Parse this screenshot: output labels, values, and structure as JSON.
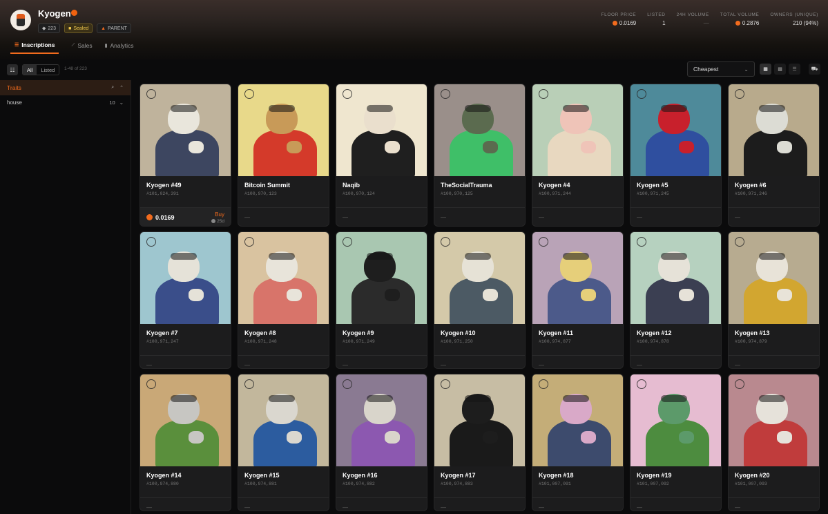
{
  "collection": {
    "name": "Kyogen",
    "badges": [
      {
        "icon": "layers-icon",
        "label": "223"
      },
      {
        "icon": "lock-icon",
        "label": "Sealed"
      },
      {
        "icon": "hierarchy-icon",
        "label": "PARENT"
      }
    ]
  },
  "stats": [
    {
      "label": "FLOOR PRICE",
      "value": "0.0169",
      "btc": true
    },
    {
      "label": "LISTED",
      "value": "1",
      "btc": false
    },
    {
      "label": "24H VOLUME",
      "value": "—",
      "btc": false
    },
    {
      "label": "TOTAL VOLUME",
      "value": "0.2876",
      "btc": true
    },
    {
      "label": "OWNERS (UNIQUE)",
      "value": "210 (94%)",
      "btc": false
    }
  ],
  "tabs": [
    {
      "label": "Inscriptions",
      "icon": "list-icon",
      "active": true
    },
    {
      "label": "Sales",
      "icon": "chart-line-icon",
      "active": false
    },
    {
      "label": "Analytics",
      "icon": "chart-bar-icon",
      "active": false
    }
  ],
  "toolbar": {
    "filter_all": "All",
    "filter_listed": "Listed",
    "count": "1-48 of 223",
    "sort": "Cheapest"
  },
  "sidebar": {
    "traits_title": "Traits",
    "traits": [
      {
        "name": "house",
        "count": "10"
      }
    ]
  },
  "colors": {
    "accent": "#f26b1d",
    "background": "#0b0b0c",
    "card": "#1c1c1d"
  },
  "items": [
    {
      "name": "Kyogen #49",
      "number": "#101,024,391",
      "price": "0.0169",
      "action": "Buy",
      "age": "25d",
      "bg": "#bfb39c",
      "skin": "#e9e6dc",
      "cloth": "#3d4660"
    },
    {
      "name": "Bitcoin Summit",
      "number": "#100,970,123",
      "price": "—",
      "bg": "#e8d98a",
      "skin": "#c89a58",
      "cloth": "#d43a2a"
    },
    {
      "name": "Naqib",
      "number": "#100,970,124",
      "price": "—",
      "bg": "#efe6cf",
      "skin": "#eadfcd",
      "cloth": "#1f1f1f"
    },
    {
      "name": "TheSocialTrauma",
      "number": "#100,970,125",
      "price": "—",
      "bg": "#9a8f8a",
      "skin": "#5b6b4f",
      "cloth": "#3fbf68"
    },
    {
      "name": "Kyogen #4",
      "number": "#100,971,244",
      "price": "—",
      "bg": "#b9cfb7",
      "skin": "#efc4b8",
      "cloth": "#e8d8c0"
    },
    {
      "name": "Kyogen #5",
      "number": "#100,971,245",
      "price": "—",
      "bg": "#4e8a9a",
      "skin": "#c8202c",
      "cloth": "#2f4f9f"
    },
    {
      "name": "Kyogen #6",
      "number": "#100,971,246",
      "price": "—",
      "bg": "#b8aa8c",
      "skin": "#dcdcd4",
      "cloth": "#1c1c1c"
    },
    {
      "name": "Kyogen #7",
      "number": "#100,971,247",
      "price": "—",
      "bg": "#9ec6cf",
      "skin": "#e5e2d8",
      "cloth": "#3a4e8a"
    },
    {
      "name": "Kyogen #8",
      "number": "#100,971,248",
      "price": "—",
      "bg": "#d9c3a0",
      "skin": "#e8e4da",
      "cloth": "#d8746a"
    },
    {
      "name": "Kyogen #9",
      "number": "#100,971,249",
      "price": "—",
      "bg": "#a9c7b1",
      "skin": "#1e1e1e",
      "cloth": "#2b2b2b"
    },
    {
      "name": "Kyogen #10",
      "number": "#100,971,250",
      "price": "—",
      "bg": "#d4c9a9",
      "skin": "#e6e2d6",
      "cloth": "#4c5a64"
    },
    {
      "name": "Kyogen #11",
      "number": "#100,974,877",
      "price": "—",
      "bg": "#b9a3b7",
      "skin": "#e6cf7a",
      "cloth": "#4c5a8a"
    },
    {
      "name": "Kyogen #12",
      "number": "#100,974,878",
      "price": "—",
      "bg": "#b6d1bf",
      "skin": "#e6e2d8",
      "cloth": "#3b3f52"
    },
    {
      "name": "Kyogen #13",
      "number": "#100,974,879",
      "price": "—",
      "bg": "#b7ab90",
      "skin": "#e8e3d8",
      "cloth": "#d2a630"
    },
    {
      "name": "Kyogen #14",
      "number": "#100,974,880",
      "price": "—",
      "bg": "#c9a877",
      "skin": "#c7c6c2",
      "cloth": "#5a8f3c"
    },
    {
      "name": "Kyogen #15",
      "number": "#100,974,881",
      "price": "—",
      "bg": "#c2b79c",
      "skin": "#dad7cf",
      "cloth": "#2c5c9f"
    },
    {
      "name": "Kyogen #16",
      "number": "#100,974,882",
      "price": "—",
      "bg": "#8a7a92",
      "skin": "#d9d5cb",
      "cloth": "#8c58b0"
    },
    {
      "name": "Kyogen #17",
      "number": "#100,974,883",
      "price": "—",
      "bg": "#c7bda4",
      "skin": "#1d1d1d",
      "cloth": "#1a1a1a"
    },
    {
      "name": "Kyogen #18",
      "number": "#101,007,091",
      "price": "—",
      "bg": "#c4ad78",
      "skin": "#d9a9c8",
      "cloth": "#3d4b6d"
    },
    {
      "name": "Kyogen #19",
      "number": "#101,007,092",
      "price": "—",
      "bg": "#e6bcd1",
      "skin": "#5c9a6a",
      "cloth": "#4d8c3f"
    },
    {
      "name": "Kyogen #20",
      "number": "#101,007,093",
      "price": "—",
      "bg": "#b9898f",
      "skin": "#e6e2da",
      "cloth": "#c03c3c"
    }
  ]
}
